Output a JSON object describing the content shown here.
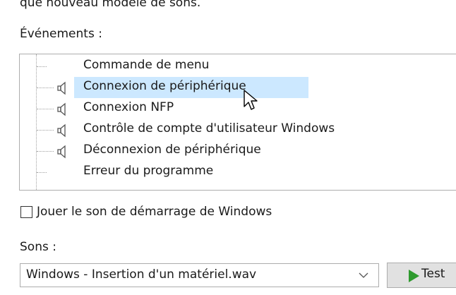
{
  "description_fragment": "que nouveau modèle de sons.",
  "events": {
    "label": "Événements :",
    "items": [
      {
        "label": "Commande de menu",
        "has_sound": false
      },
      {
        "label": "Connexion de périphérique",
        "has_sound": true,
        "selected": true
      },
      {
        "label": "Connexion NFP",
        "has_sound": true
      },
      {
        "label": "Contrôle de compte d'utilisateur Windows",
        "has_sound": true
      },
      {
        "label": "Déconnexion de périphérique",
        "has_sound": true
      },
      {
        "label": "Erreur du programme",
        "has_sound": false
      }
    ]
  },
  "startup_sound": {
    "label": "Jouer le son de démarrage de Windows",
    "checked": false
  },
  "sounds": {
    "label": "Sons :",
    "selected": "Windows - Insertion d'un matériel.wav"
  },
  "test_button": {
    "label": "Test"
  },
  "colors": {
    "selection": "#cce8ff",
    "play": "#2e9a2e"
  }
}
